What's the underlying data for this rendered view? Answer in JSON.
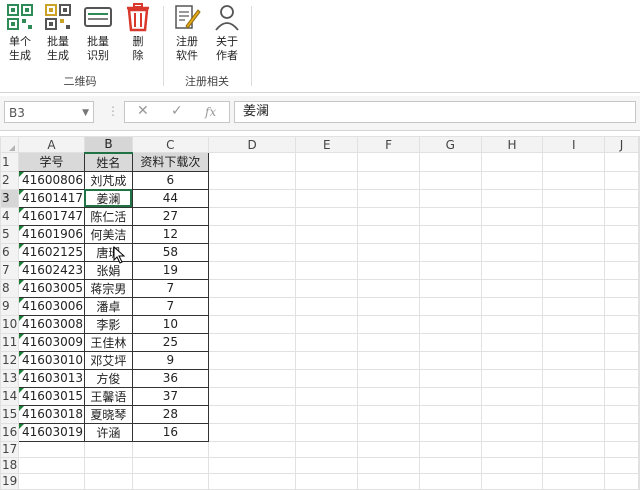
{
  "ribbon": {
    "qr_group": {
      "label": "二维码",
      "buttons": [
        {
          "label": "单个\n生成",
          "icon": "qr-code-icon"
        },
        {
          "label": "批量\n生成",
          "icon": "qr-batch-icon"
        },
        {
          "label": "批量\n识别",
          "icon": "scanner-icon"
        },
        {
          "label": "删\n除",
          "icon": "trash-icon"
        }
      ]
    },
    "reg_group": {
      "label": "注册相关",
      "buttons": [
        {
          "label": "注册\n软件",
          "icon": "register-pen-icon"
        },
        {
          "label": "关于\n作者",
          "icon": "person-icon"
        }
      ]
    }
  },
  "formula_bar": {
    "name_box": "B3",
    "formula": "姜澜",
    "fx": "fx"
  },
  "sheet": {
    "columns": [
      "A",
      "B",
      "C",
      "D",
      "E",
      "F",
      "G",
      "H",
      "I",
      "J"
    ],
    "selected_column": "B",
    "selected_row": 3,
    "row_count": 19,
    "header": [
      "学号",
      "姓名",
      "资料下载次"
    ],
    "rows": [
      [
        "41600806",
        "刘芃成",
        "6"
      ],
      [
        "41601417",
        "姜澜",
        "44"
      ],
      [
        "41601747",
        "陈仁活",
        "27"
      ],
      [
        "41601906",
        "何美洁",
        "12"
      ],
      [
        "41602125",
        "唐珊",
        "58"
      ],
      [
        "41602423",
        "张娟",
        "19"
      ],
      [
        "41603005",
        "蒋宗男",
        "7"
      ],
      [
        "41603006",
        "潘卓",
        "7"
      ],
      [
        "41603008",
        "李影",
        "10"
      ],
      [
        "41603009",
        "王佳林",
        "25"
      ],
      [
        "41603010",
        "邓艾坪",
        "9"
      ],
      [
        "41603013",
        "方俊",
        "36"
      ],
      [
        "41603015",
        "王馨语",
        "37"
      ],
      [
        "41603018",
        "夏晓琴",
        "28"
      ],
      [
        "41603019",
        "许涵",
        "16"
      ]
    ]
  },
  "colors": {
    "accent": "#217346",
    "delete_red": "#d9382c",
    "qr_green": "#2e8b57"
  }
}
